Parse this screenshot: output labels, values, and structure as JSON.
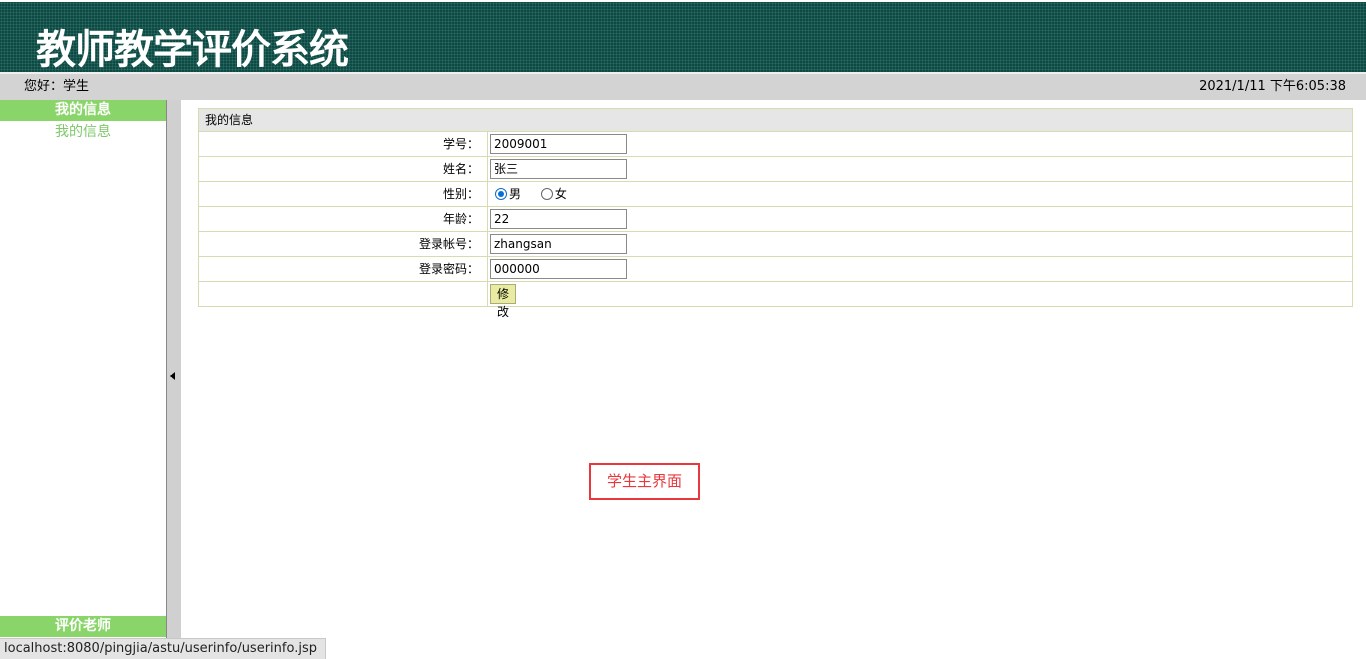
{
  "header": {
    "title": "教师教学评价系统"
  },
  "status": {
    "greeting": "您好：学生",
    "datetime": "2021/1/11 下午6:05:38"
  },
  "sidebar": {
    "sections": [
      {
        "title": "我的信息",
        "items": [
          "我的信息"
        ]
      },
      {
        "title": "评价老师",
        "items": []
      }
    ]
  },
  "panel": {
    "title": "我的信息",
    "fields": [
      {
        "label": "学号：",
        "value": "2009001"
      },
      {
        "label": "姓名：",
        "value": "张三"
      },
      {
        "label": "性别：",
        "options": [
          "男",
          "女"
        ],
        "selected": "男"
      },
      {
        "label": "年龄：",
        "value": "22"
      },
      {
        "label": "登录帐号：",
        "value": "zhangsan"
      },
      {
        "label": "登录密码：",
        "value": "000000"
      }
    ],
    "submit_label": "修改"
  },
  "annotation": "学生主界面",
  "browser": {
    "status_url": "localhost:8080/pingjia/astu/userinfo/userinfo.jsp"
  },
  "colors": {
    "header_bg": "#0e4a44",
    "menu_green": "#8ad56a",
    "annotation_red": "#e8383d",
    "radio_blue": "#0a6ed1"
  }
}
